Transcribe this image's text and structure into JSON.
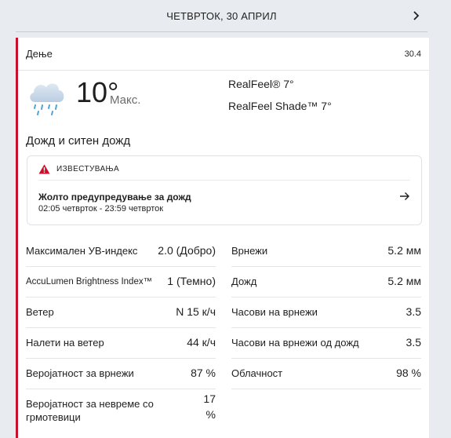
{
  "header": {
    "date": "ЧЕТВРТОК, 30 АПРИЛ"
  },
  "card": {
    "label": "Дење",
    "date": "30.4",
    "temperature": "10°",
    "temp_label": "Макс.",
    "realfeel": "RealFeel® 7°",
    "realfeel_shade": "RealFeel Shade™ 7°",
    "phrase": "Дожд и ситен дожд",
    "icon": "cloud-rain-icon",
    "alert": {
      "kicker": "ИЗВЕСТУВАЊА",
      "title": "Жолто предупредување за дожд",
      "time": "02:05 четврток - 23:59 четврток"
    }
  },
  "details_left": [
    {
      "label": "Максимален УВ-индекс",
      "value": "2.0 (Добро)"
    },
    {
      "label": "AccuLumen Brightness Index™",
      "value": "1 (Темно)"
    },
    {
      "label": "Ветер",
      "value": "N 15 к/ч"
    },
    {
      "label": "Налети на ветер",
      "value": "44 к/ч"
    },
    {
      "label": "Веројатност за врнежи",
      "value": "87 %"
    },
    {
      "label": "Веројатност за невреме со грмотевици",
      "value": "17 %"
    }
  ],
  "details_right": [
    {
      "label": "Врнежи",
      "value": "5.2 мм"
    },
    {
      "label": "Дожд",
      "value": "5.2 мм"
    },
    {
      "label": "Часови на врнежи",
      "value": "3.5"
    },
    {
      "label": "Часови на врнежи од дожд",
      "value": "3.5"
    },
    {
      "label": "Облачност",
      "value": "98 %"
    }
  ],
  "colors": {
    "accent": "#c8102e",
    "background": "#e8ecf1",
    "card": "#ffffff"
  }
}
